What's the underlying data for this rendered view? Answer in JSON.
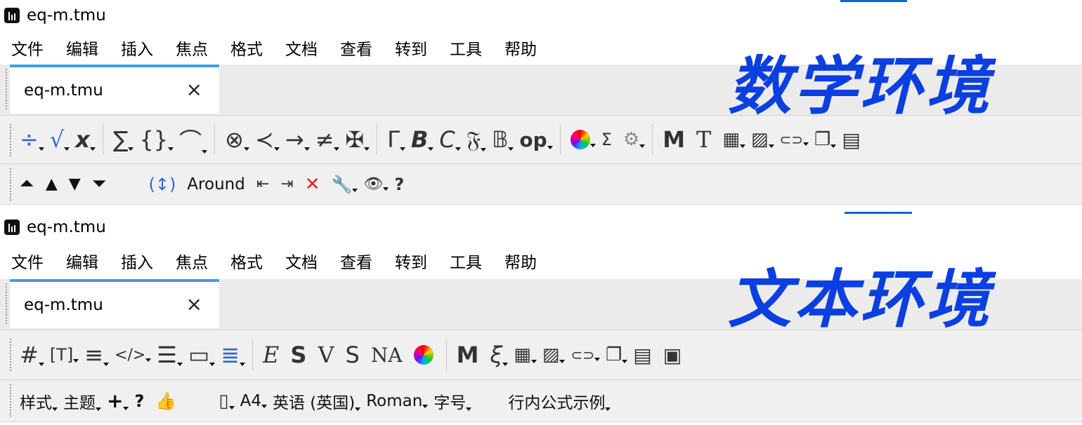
{
  "window_math": {
    "title": "eq-m.tmu",
    "menu": [
      "文件",
      "编辑",
      "插入",
      "焦点",
      "格式",
      "文档",
      "查看",
      "转到",
      "工具",
      "帮助"
    ],
    "tab_label": "eq-m.tmu",
    "overlay_label": "数学环境",
    "toolbar1": [
      "÷",
      "√",
      "x",
      "∑",
      "{}",
      "⌒",
      "⊗",
      "≺",
      "→",
      "≠",
      "✠",
      "Γ",
      "B",
      "C",
      "𝔉",
      "𝔹",
      "op",
      "",
      "Σ",
      "⚙",
      "M",
      "T",
      "▦",
      "▨",
      "⊂⊃",
      "❐",
      "▤"
    ],
    "toolbar2": {
      "items": [
        "⏶",
        "▲",
        "▼",
        "⏷",
        "(↕)",
        "Around",
        "⇤",
        "⇥",
        "✕",
        "🔧",
        "👁",
        "?"
      ]
    }
  },
  "window_text": {
    "title": "eq-m.tmu",
    "menu": [
      "文件",
      "编辑",
      "插入",
      "焦点",
      "格式",
      "文档",
      "查看",
      "转到",
      "工具",
      "帮助"
    ],
    "tab_label": "eq-m.tmu",
    "overlay_label": "文本环境",
    "toolbar1": [
      "#",
      "[T]",
      "≡",
      "</>",
      "☰",
      "▭",
      "≣",
      "E",
      "S",
      "V",
      "S",
      "NA",
      "",
      "M",
      "ξ",
      "▦",
      "▨",
      "⊂⊃",
      "❐",
      "▤",
      "▣"
    ],
    "toolbar2": [
      "样式",
      "主题",
      "+",
      "?",
      "👍",
      "▯",
      "A4",
      "英语 (英国)",
      "Roman",
      "字号",
      "行内公式示例"
    ]
  },
  "icons": {
    "close": "close-icon",
    "app": "app-icon"
  },
  "colors": {
    "overlay": "#0b3fe0",
    "tab_accent": "#3aa0e0",
    "delete": "#e02525"
  }
}
